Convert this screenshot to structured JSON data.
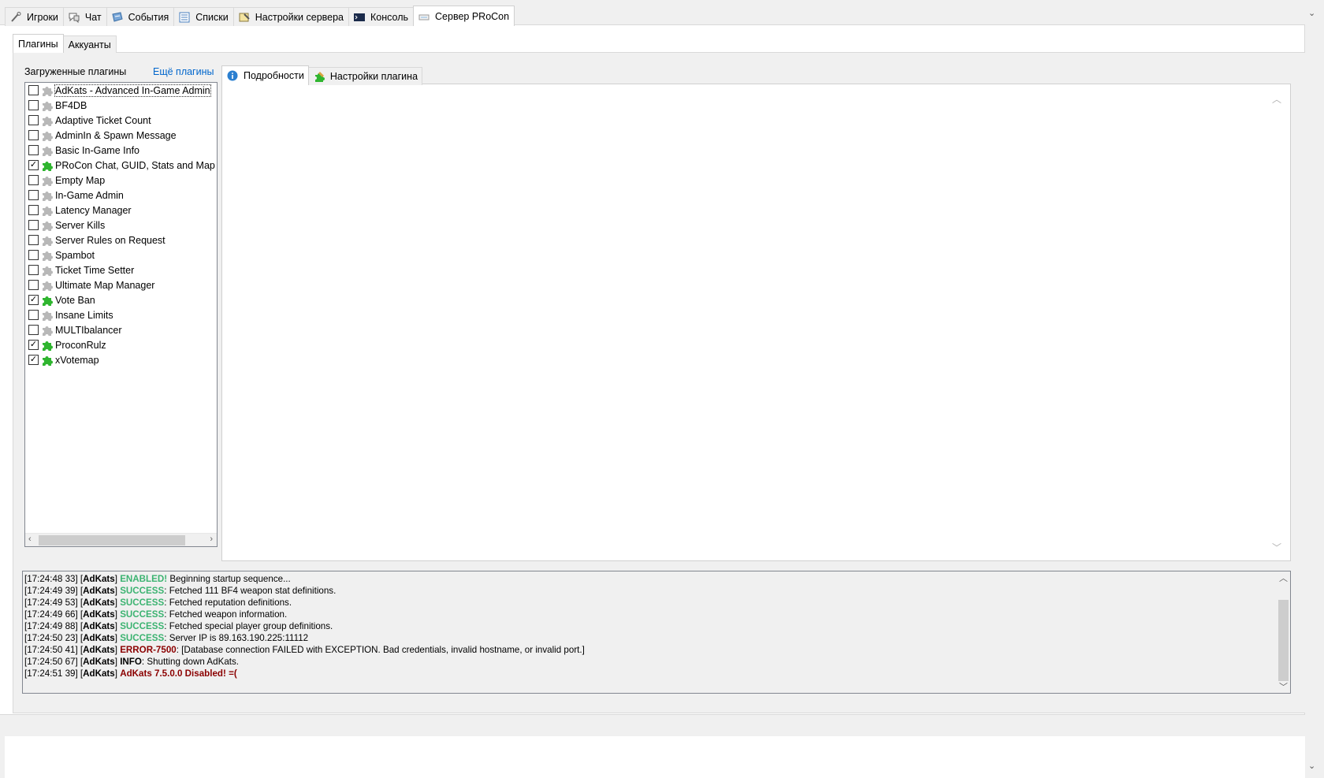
{
  "top_tabs": [
    {
      "label": "Игроки",
      "icon": "player-icon"
    },
    {
      "label": "Чат",
      "icon": "chat-icon"
    },
    {
      "label": "События",
      "icon": "events-icon"
    },
    {
      "label": "Списки",
      "icon": "lists-icon"
    },
    {
      "label": "Настройки сервера",
      "icon": "server-settings-icon"
    },
    {
      "label": "Консоль",
      "icon": "console-icon"
    },
    {
      "label": "Сервер PRoCon",
      "icon": "procon-server-icon",
      "active": true
    }
  ],
  "sub_tabs": [
    {
      "label": "Плагины",
      "active": true
    },
    {
      "label": "Аккуанты"
    }
  ],
  "plugins_panel": {
    "loaded_label": "Загруженные плагины",
    "more_link": "Ещё плагины",
    "items": [
      {
        "label": "AdKats - Advanced In-Game Admin",
        "checked": false,
        "selected": true
      },
      {
        "label": "BF4DB",
        "checked": false
      },
      {
        "label": "Adaptive Ticket Count",
        "checked": false
      },
      {
        "label": "AdminIn & Spawn Message",
        "checked": false
      },
      {
        "label": "Basic In-Game Info",
        "checked": false
      },
      {
        "label": "PRoCon Chat, GUID, Stats and Map Logger",
        "checked": true
      },
      {
        "label": "Empty Map",
        "checked": false
      },
      {
        "label": "In-Game Admin",
        "checked": false
      },
      {
        "label": "Latency Manager",
        "checked": false
      },
      {
        "label": "Server Kills",
        "checked": false
      },
      {
        "label": "Server Rules on Request",
        "checked": false
      },
      {
        "label": "Spambot",
        "checked": false
      },
      {
        "label": "Ticket Time Setter",
        "checked": false
      },
      {
        "label": "Ultimate Map Manager",
        "checked": false
      },
      {
        "label": "Vote Ban",
        "checked": true
      },
      {
        "label": "Insane Limits",
        "checked": false
      },
      {
        "label": "MULTIbalancer",
        "checked": false
      },
      {
        "label": "ProconRulz",
        "checked": true
      },
      {
        "label": "xVotemap",
        "checked": true
      }
    ]
  },
  "detail_tabs": [
    {
      "label": "Подробности",
      "icon": "info-icon",
      "active": true
    },
    {
      "label": "Настройки плагина",
      "icon": "plugin-settings-icon"
    }
  ],
  "log": [
    {
      "time": "[17:24:48 33]",
      "source": "AdKats",
      "tag": "ENABLED!",
      "tag_type": "ok",
      "message": " Beginning startup sequence..."
    },
    {
      "time": "[17:24:49 39]",
      "source": "AdKats",
      "tag": "SUCCESS",
      "tag_type": "ok",
      "message": ": Fetched 111 BF4 weapon stat definitions."
    },
    {
      "time": "[17:24:49 53]",
      "source": "AdKats",
      "tag": "SUCCESS",
      "tag_type": "ok",
      "message": ": Fetched reputation definitions."
    },
    {
      "time": "[17:24:49 66]",
      "source": "AdKats",
      "tag": "SUCCESS",
      "tag_type": "ok",
      "message": ": Fetched weapon information."
    },
    {
      "time": "[17:24:49 88]",
      "source": "AdKats",
      "tag": "SUCCESS",
      "tag_type": "ok",
      "message": ": Fetched special player group definitions."
    },
    {
      "time": "[17:24:50 23]",
      "source": "AdKats",
      "tag": "SUCCESS",
      "tag_type": "ok",
      "message": ": Server IP is 89.163.190.225:11112"
    },
    {
      "time": "[17:24:50 41]",
      "source": "AdKats",
      "tag": "ERROR-7500",
      "tag_type": "err",
      "message": ": [Database connection FAILED with EXCEPTION. Bad credentials, invalid hostname, or invalid port.]"
    },
    {
      "time": "[17:24:50 67]",
      "source": "AdKats",
      "tag": "INFO",
      "tag_type": "bold",
      "message": ": Shutting down AdKats."
    },
    {
      "time": "[17:24:51 39]",
      "source": "AdKats",
      "tag": "AdKats 7.5.0.0 Disabled! =(",
      "tag_type": "err",
      "message": ""
    }
  ],
  "colors": {
    "success": "#3cb371",
    "error": "#8b0000",
    "link": "#0066cc",
    "plugin_enabled": "#2fb52f",
    "plugin_disabled": "#b8b8b8"
  }
}
